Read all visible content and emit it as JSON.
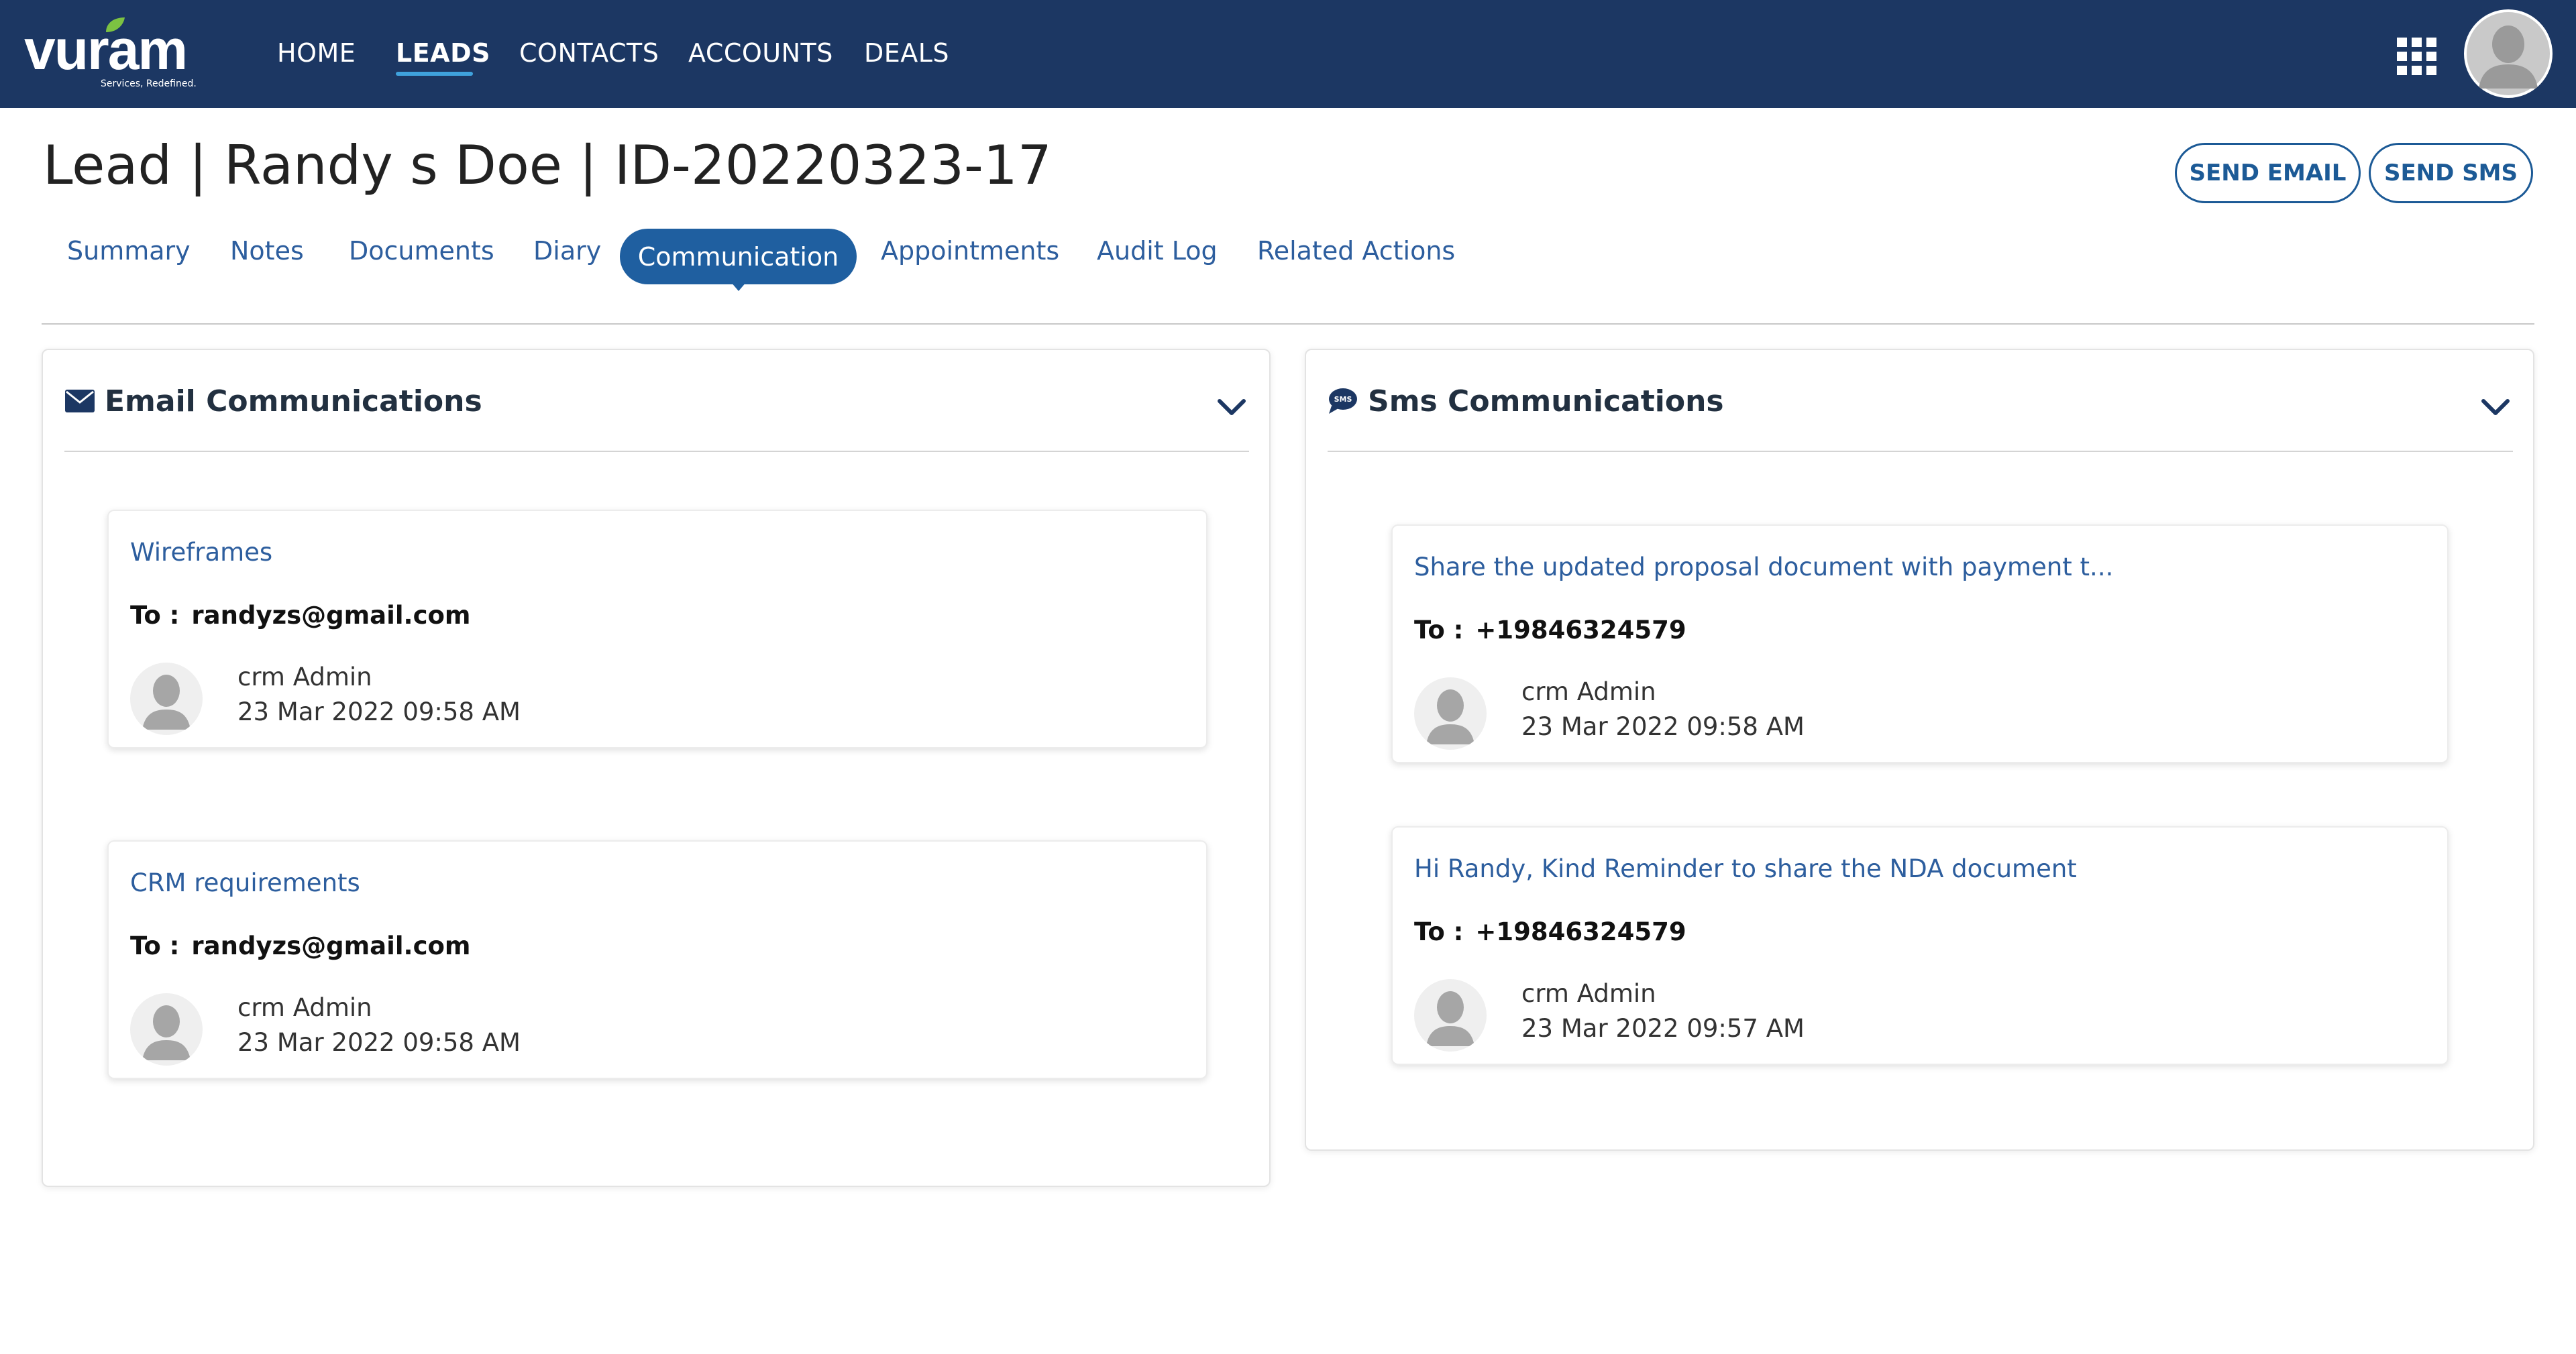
{
  "app": {
    "logo_text": "vuram",
    "logo_tagline": "Services, Redefined.",
    "brand_color": "#1c3763",
    "accent_color": "#1f5fa0"
  },
  "nav": {
    "items": [
      {
        "label": "HOME",
        "active": false
      },
      {
        "label": "LEADS",
        "active": true
      },
      {
        "label": "CONTACTS",
        "active": false
      },
      {
        "label": "ACCOUNTS",
        "active": false
      },
      {
        "label": "DEALS",
        "active": false
      }
    ],
    "apps_icon": "grid-icon",
    "profile_icon": "user-avatar-icon"
  },
  "header": {
    "title": "Lead | Randy s Doe | ID-20220323-17",
    "send_email_label": "SEND EMAIL",
    "send_sms_label": "SEND SMS"
  },
  "tabs": [
    {
      "label": "Summary",
      "active": false
    },
    {
      "label": "Notes",
      "active": false
    },
    {
      "label": "Documents",
      "active": false
    },
    {
      "label": "Diary",
      "active": false
    },
    {
      "label": "Communication",
      "active": true
    },
    {
      "label": "Appointments",
      "active": false
    },
    {
      "label": "Audit Log",
      "active": false
    },
    {
      "label": "Related Actions",
      "active": false
    }
  ],
  "email_panel": {
    "title": "Email Communications",
    "icon": "envelope-icon",
    "items": [
      {
        "subject": "Wireframes",
        "to_label": "To :",
        "to": "randyzs@gmail.com",
        "author": "crm Admin",
        "date": "23 Mar 2022 09:58 AM"
      },
      {
        "subject": "CRM requirements",
        "to_label": "To :",
        "to": "randyzs@gmail.com",
        "author": "crm Admin",
        "date": "23 Mar 2022 09:58 AM"
      }
    ]
  },
  "sms_panel": {
    "title": "Sms Communications",
    "icon": "sms-bubble-icon",
    "items": [
      {
        "subject": "Share the updated proposal document with payment t...",
        "to_label": "To :",
        "to": "+19846324579",
        "author": "crm Admin",
        "date": "23 Mar 2022 09:58 AM"
      },
      {
        "subject": "Hi Randy, Kind Reminder to share the NDA document",
        "to_label": "To :",
        "to": "+19846324579",
        "author": "crm Admin",
        "date": "23 Mar 2022 09:57 AM"
      }
    ]
  }
}
